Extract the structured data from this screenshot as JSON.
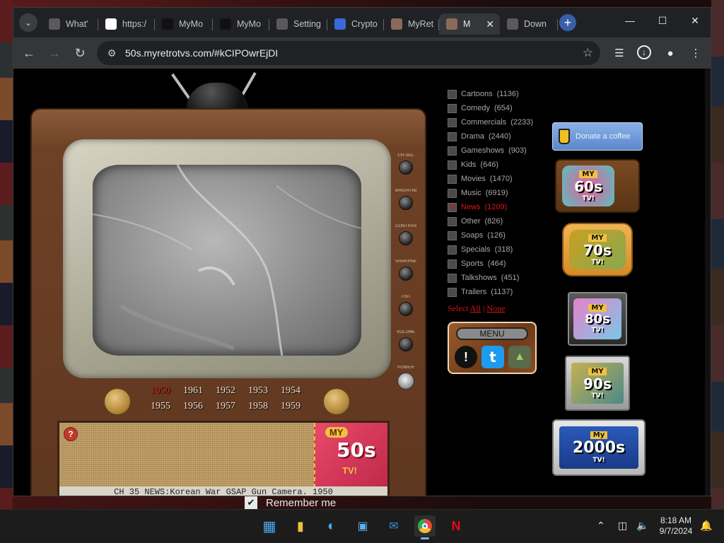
{
  "browser": {
    "tabs": [
      {
        "title": "What'",
        "favicon": "whatsapp-icon",
        "color": "#5a5a5a"
      },
      {
        "title": "https:/",
        "favicon": "google-icon",
        "color": "#ffffff"
      },
      {
        "title": "MyMo",
        "favicon": "mymovies-icon",
        "color": "#111111"
      },
      {
        "title": "MyMo",
        "favicon": "mymovies-icon",
        "color": "#111111"
      },
      {
        "title": "Setting",
        "favicon": "gear-icon",
        "color": "#5a5a5a"
      },
      {
        "title": "Crypto",
        "favicon": "cloud-icon",
        "color": "#3a6ad8"
      },
      {
        "title": "MyRet",
        "favicon": "myretro-icon",
        "color": "#8a6a5a"
      },
      {
        "title": "M",
        "favicon": "myretro-icon",
        "color": "#8a6a5a"
      },
      {
        "title": "Down",
        "favicon": "download-icon",
        "color": "#5a5a5a"
      }
    ],
    "new_tab": "+",
    "url": "50s.myretrotvs.com/#kCIPOwrEjDI"
  },
  "tv": {
    "years_row1": [
      "1950",
      "1961",
      "1952",
      "1953",
      "1954"
    ],
    "years_row2": [
      "1955",
      "1956",
      "1957",
      "1958",
      "1959"
    ],
    "selected_year": "1950",
    "knobs": [
      "CH-SEL",
      "BRIGHTNESS",
      "CONTRAST",
      "SHARPNESS",
      "TINT",
      "VOLUME",
      "POWER"
    ],
    "ticker": "CH 35 NEWS:Korean War GSAP Gun Camera. 1950",
    "logo": {
      "my": "MY",
      "decade": "50s",
      "tv": "TV!"
    }
  },
  "categories": [
    {
      "name": "Cartoons",
      "count": "(1136)",
      "checked": false
    },
    {
      "name": "Comedy",
      "count": "(654)",
      "checked": false
    },
    {
      "name": "Commercials",
      "count": "(2233)",
      "checked": false
    },
    {
      "name": "Drama",
      "count": "(2440)",
      "checked": false
    },
    {
      "name": "Gameshows",
      "count": "(903)",
      "checked": false
    },
    {
      "name": "Kids",
      "count": "(646)",
      "checked": false
    },
    {
      "name": "Movies",
      "count": "(1470)",
      "checked": false
    },
    {
      "name": "Music",
      "count": "(6919)",
      "checked": false
    },
    {
      "name": "News",
      "count": "(1209)",
      "checked": true
    },
    {
      "name": "Other",
      "count": "(826)",
      "checked": false
    },
    {
      "name": "Soaps",
      "count": "(126)",
      "checked": false
    },
    {
      "name": "Specials",
      "count": "(318)",
      "checked": false
    },
    {
      "name": "Sports",
      "count": "(464)",
      "checked": false
    },
    {
      "name": "Talkshows",
      "count": "(451)",
      "checked": false
    },
    {
      "name": "Trailers",
      "count": "(1137)",
      "checked": false
    }
  ],
  "select": {
    "prefix": "Select",
    "all": "All",
    "divider": "|",
    "none": "None"
  },
  "menu": {
    "label": "MENU",
    "items": [
      "!",
      "t",
      "▲"
    ]
  },
  "donate": {
    "label": "Donate a coffee"
  },
  "decades": [
    {
      "my": "MY",
      "decade": "60s",
      "tv": "TV!"
    },
    {
      "my": "MY",
      "decade": "70s",
      "tv": "TV!"
    },
    {
      "my": "MY",
      "decade": "80s",
      "tv": "TV!"
    },
    {
      "my": "MY",
      "decade": "90s",
      "tv": "TV!"
    },
    {
      "my": "My",
      "decade": "2000s",
      "tv": "TV!"
    }
  ],
  "page": {
    "remember_me": "Remember me",
    "check": "✔"
  },
  "taskbar": {
    "time": "8:18 AM",
    "date": "9/7/2024"
  }
}
